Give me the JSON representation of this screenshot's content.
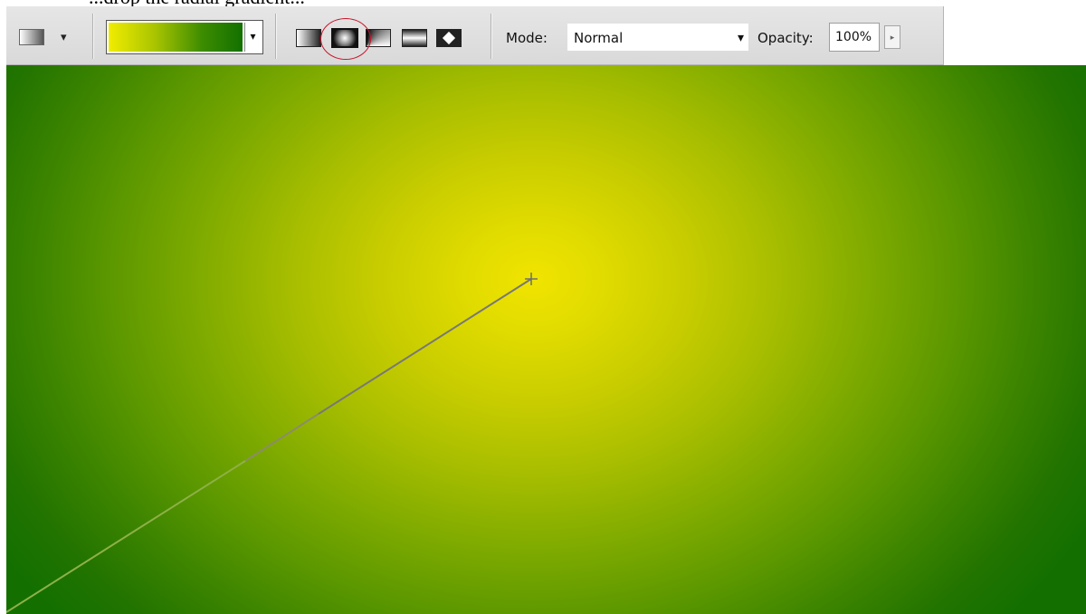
{
  "caption": {
    "text": "...drop the radial gradient..."
  },
  "options_bar": {
    "preset_arrow": "▾",
    "gradient_dropdown_arrow": "▾",
    "gradient_type_buttons": [
      {
        "name": "linear-gradient",
        "icon": "linear-gradient-icon"
      },
      {
        "name": "radial-gradient",
        "icon": "radial-gradient-icon",
        "selected": true
      },
      {
        "name": "angle-gradient",
        "icon": "angle-gradient-icon"
      },
      {
        "name": "reflected-gradient",
        "icon": "reflected-gradient-icon"
      },
      {
        "name": "diamond-gradient",
        "icon": "diamond-gradient-icon"
      }
    ],
    "mode_label": "Mode:",
    "mode_value": "Normal",
    "mode_arrow": "▾",
    "opacity_label": "Opacity:",
    "opacity_value": "100%",
    "opacity_arrow": "▸"
  },
  "canvas": {
    "gradient_start_color": "#f1e400",
    "gradient_end_color": "#137000"
  },
  "highlight_color": "#c8142a"
}
